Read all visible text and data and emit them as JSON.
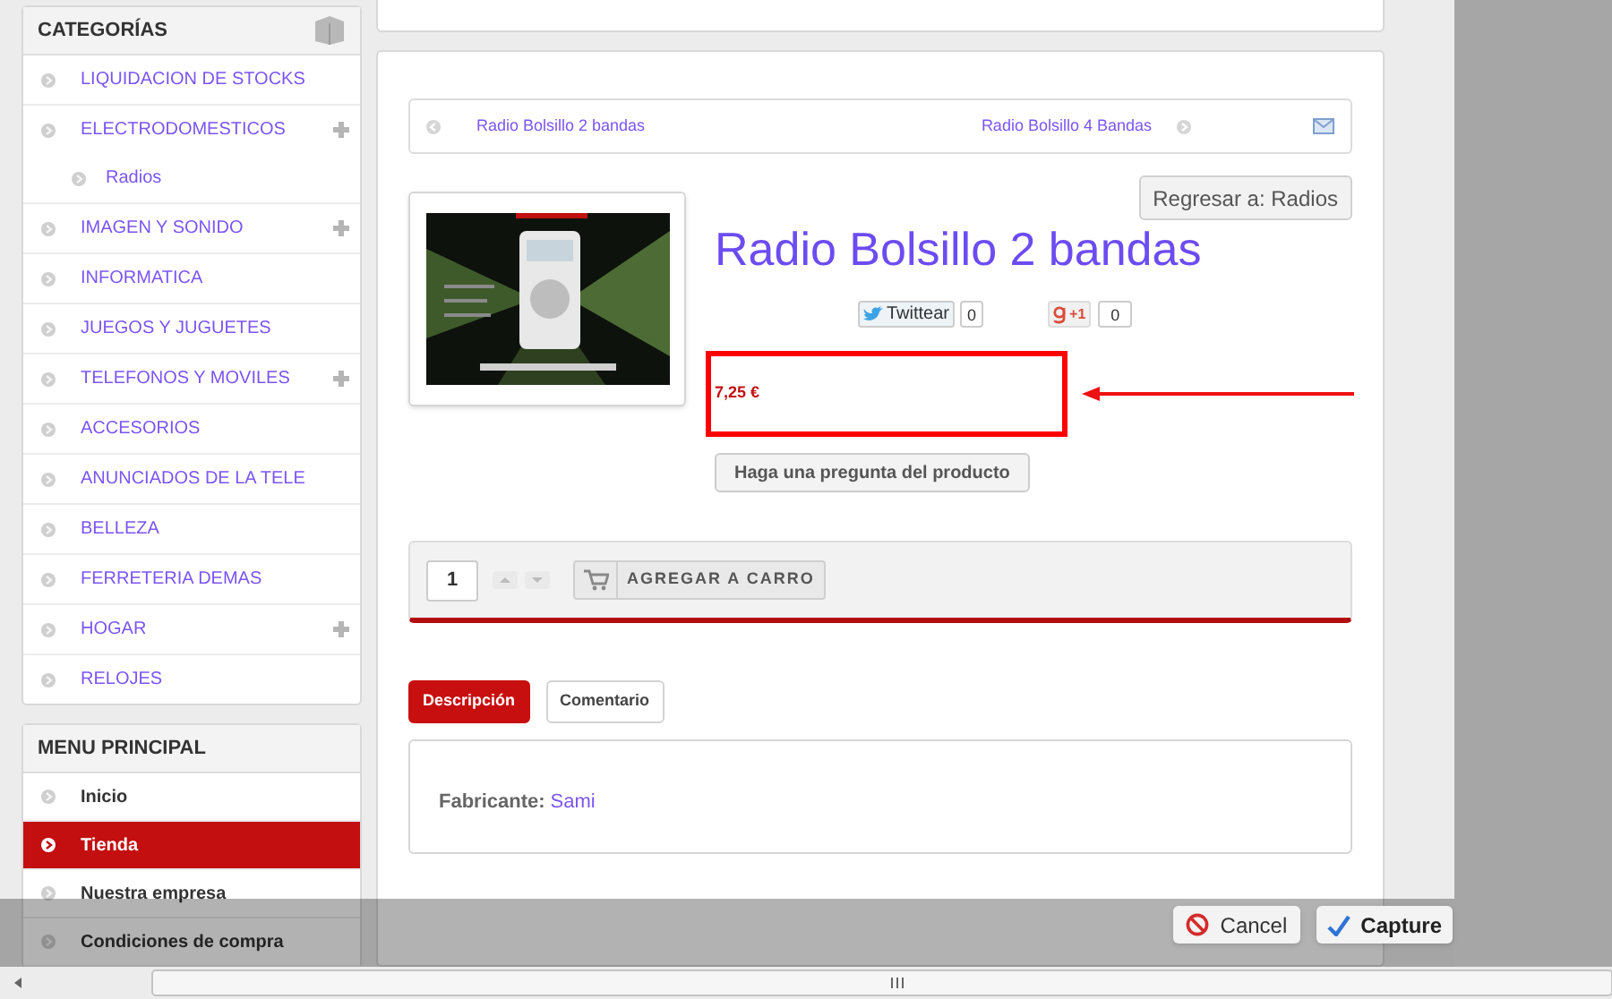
{
  "categories": {
    "title": "CATEGORÍAS",
    "items": [
      {
        "label": "LIQUIDACION DE STOCKS",
        "expandable": false
      },
      {
        "label": "ELECTRODOMESTICOS",
        "expandable": true,
        "children": [
          {
            "label": "Radios"
          }
        ]
      },
      {
        "label": "IMAGEN Y SONIDO",
        "expandable": true
      },
      {
        "label": "INFORMATICA",
        "expandable": false
      },
      {
        "label": "JUEGOS Y JUGUETES",
        "expandable": false
      },
      {
        "label": "TELEFONOS Y MOVILES",
        "expandable": true
      },
      {
        "label": "ACCESORIOS",
        "expandable": false
      },
      {
        "label": "ANUNCIADOS DE LA TELE",
        "expandable": false
      },
      {
        "label": "BELLEZA",
        "expandable": false
      },
      {
        "label": "FERRETERIA DEMAS",
        "expandable": false
      },
      {
        "label": "HOGAR",
        "expandable": true
      },
      {
        "label": "RELOJES",
        "expandable": false
      }
    ]
  },
  "main_menu": {
    "title": "MENU PRINCIPAL",
    "items": [
      {
        "label": "Inicio",
        "selected": false
      },
      {
        "label": "Tienda",
        "selected": true
      },
      {
        "label": "Nuestra empresa",
        "selected": false
      },
      {
        "label": "Condiciones de compra",
        "selected": false
      }
    ]
  },
  "product_nav": {
    "previous": "Radio Bolsillo 2 bandas",
    "next": "Radio Bolsillo 4 Bandas"
  },
  "back_button": "Regresar a: Radios",
  "product": {
    "title": "Radio Bolsillo 2 bandas",
    "price": "7,25 €",
    "ask_button": "Haga una pregunta del producto"
  },
  "social": {
    "tweet": "Twittear",
    "tweet_count": "0",
    "plus": "+1",
    "plus_count": "0"
  },
  "cart": {
    "quantity": "1",
    "add_button": "AGREGAR A CARRO"
  },
  "tabs": [
    {
      "label": "Descripción",
      "selected": true
    },
    {
      "label": "Comentario",
      "selected": false
    }
  ],
  "description": {
    "label": "Fabricante:",
    "value": "Sami"
  },
  "capture_bar": {
    "cancel": "Cancel",
    "capture": "Capture"
  }
}
